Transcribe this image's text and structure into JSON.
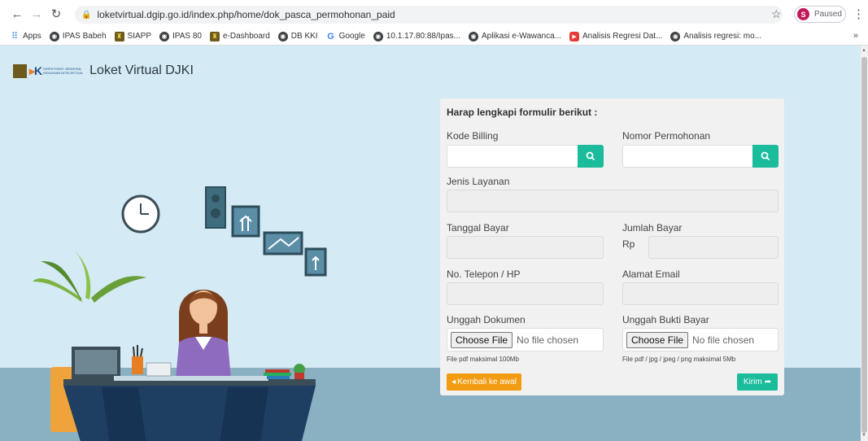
{
  "browser": {
    "url": "loketvirtual.dgip.go.id/index.php/home/dok_pasca_permohonan_paid",
    "profile_initial": "S",
    "profile_status": "Paused",
    "bookmarks": [
      {
        "label": "Apps",
        "icon": "apps-grid-icon"
      },
      {
        "label": "IPAS Babeh",
        "icon": "globe-icon"
      },
      {
        "label": "SIAPP",
        "icon": "djki-logo-icon"
      },
      {
        "label": "IPAS 80",
        "icon": "globe-icon"
      },
      {
        "label": "e-Dashboard",
        "icon": "djki-logo-icon"
      },
      {
        "label": "DB KKI",
        "icon": "globe-icon"
      },
      {
        "label": "Google",
        "icon": "google-icon"
      },
      {
        "label": "10.1.17.80:88/Ipas...",
        "icon": "globe-icon"
      },
      {
        "label": "Aplikasi e-Wawanca...",
        "icon": "globe-icon"
      },
      {
        "label": "Analisis Regresi Dat...",
        "icon": "youtube-icon"
      },
      {
        "label": "Analisis regresi: mo...",
        "icon": "globe-icon"
      }
    ]
  },
  "header": {
    "brand_small_text": "DIREKTORAT JENDERAL KEKAYAAN INTELEKTUAL",
    "site_title": "Loket Virtual DJKI"
  },
  "form": {
    "heading": "Harap lengkapi formulir berikut :",
    "kode_billing_label": "Kode Billing",
    "nomor_permohonan_label": "Nomor Permohonan",
    "jenis_layanan_label": "Jenis Layanan",
    "tanggal_bayar_label": "Tanggal Bayar",
    "jumlah_bayar_label": "Jumlah Bayar",
    "currency_prefix": "Rp",
    "telepon_label": "No. Telepon / HP",
    "email_label": "Alamat Email",
    "unggah_dokumen_label": "Unggah Dokumen",
    "unggah_bukti_label": "Unggah Bukti Bayar",
    "choose_file": "Choose File",
    "no_file": "No file chosen",
    "dokumen_hint": "File pdf maksimal 100Mb",
    "bukti_hint": "File pdf / jpg / jpeg / png maksimal 5Mb",
    "back_button": "Kembali ke awal",
    "submit_button": "Kirim"
  },
  "colors": {
    "accent_teal": "#1abc9c",
    "back_orange": "#f39c12",
    "sky_background": "#d4eaf4",
    "floor": "#8ab1c2"
  }
}
